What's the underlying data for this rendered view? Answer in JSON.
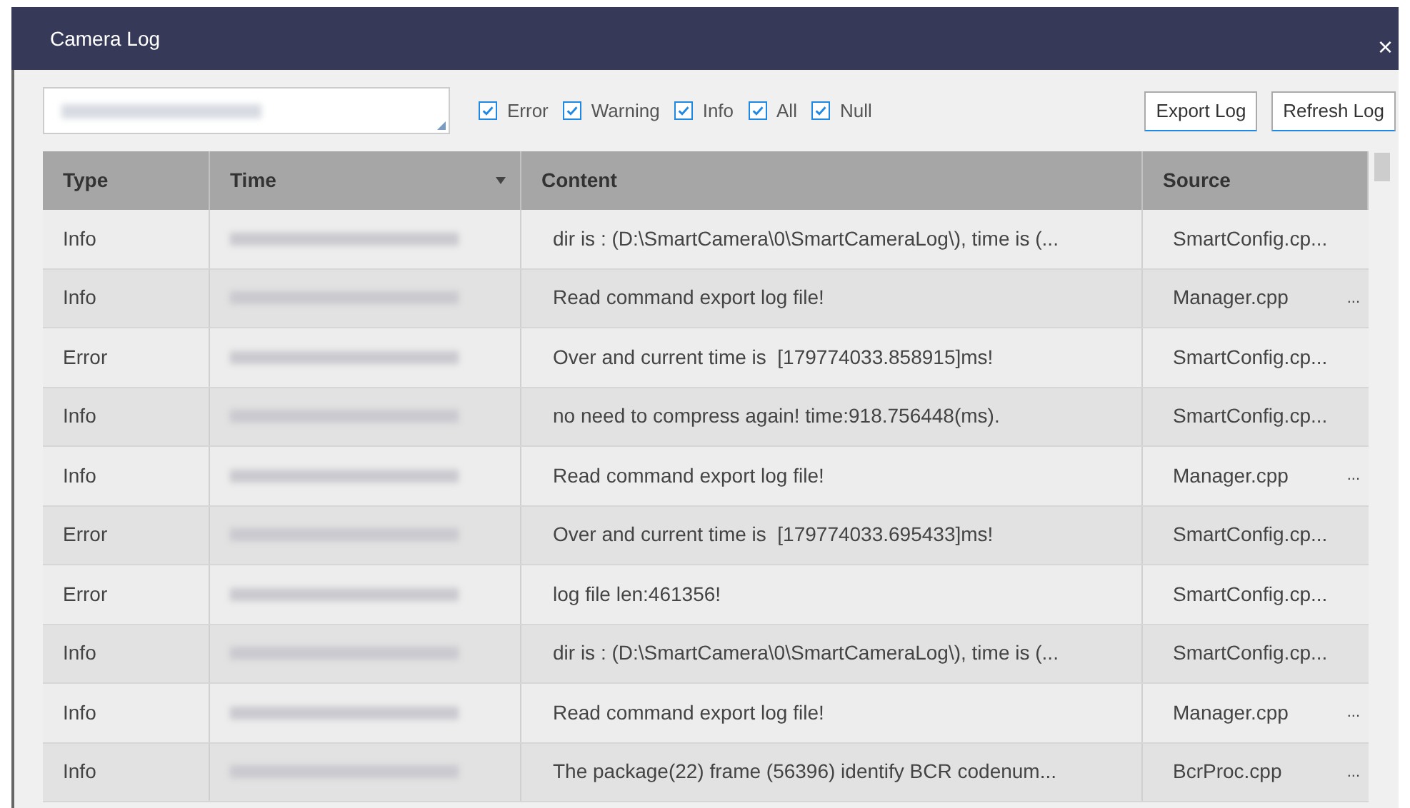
{
  "window": {
    "title": "Camera Log",
    "close": "×"
  },
  "filters": [
    {
      "label": "Error",
      "checked": true
    },
    {
      "label": "Warning",
      "checked": true
    },
    {
      "label": "Info",
      "checked": true
    },
    {
      "label": "All",
      "checked": true
    },
    {
      "label": "Null",
      "checked": true
    }
  ],
  "buttons": [
    "Export Log",
    "Refresh Log"
  ],
  "table": {
    "columns": [
      {
        "label": "Type",
        "sort": false
      },
      {
        "label": "Time",
        "sort": true
      },
      {
        "label": "Content",
        "sort": false
      },
      {
        "label": "Source",
        "sort": false
      }
    ],
    "rows": [
      {
        "type": "Info",
        "content": "dir is : (D:\\SmartCamera\\0\\SmartCameraLog\\), time is (...",
        "source": "SmartConfig.cp..."
      },
      {
        "type": "Info",
        "content": "Read command export log file!",
        "source": "Manager.cpp",
        "source_more": "..."
      },
      {
        "type": "Error",
        "content": "Over and current time is  [179774033.858915]ms!",
        "source": "SmartConfig.cp..."
      },
      {
        "type": "Info",
        "content": "no need to compress again! time:918.756448(ms).",
        "source": "SmartConfig.cp..."
      },
      {
        "type": "Info",
        "content": "Read command export log file!",
        "source": "Manager.cpp",
        "source_more": "..."
      },
      {
        "type": "Error",
        "content": "Over and current time is  [179774033.695433]ms!",
        "source": "SmartConfig.cp..."
      },
      {
        "type": "Error",
        "content": "log file len:461356!",
        "source": "SmartConfig.cp..."
      },
      {
        "type": "Info",
        "content": "dir is : (D:\\SmartCamera\\0\\SmartCameraLog\\), time is (...",
        "source": "SmartConfig.cp..."
      },
      {
        "type": "Info",
        "content": "Read command export log file!",
        "source": "Manager.cpp",
        "source_more": "..."
      },
      {
        "type": "Info",
        "content": "The package(22) frame (56396) identify BCR codenum...",
        "source": "BcrProc.cpp",
        "source_more": "..."
      }
    ]
  }
}
